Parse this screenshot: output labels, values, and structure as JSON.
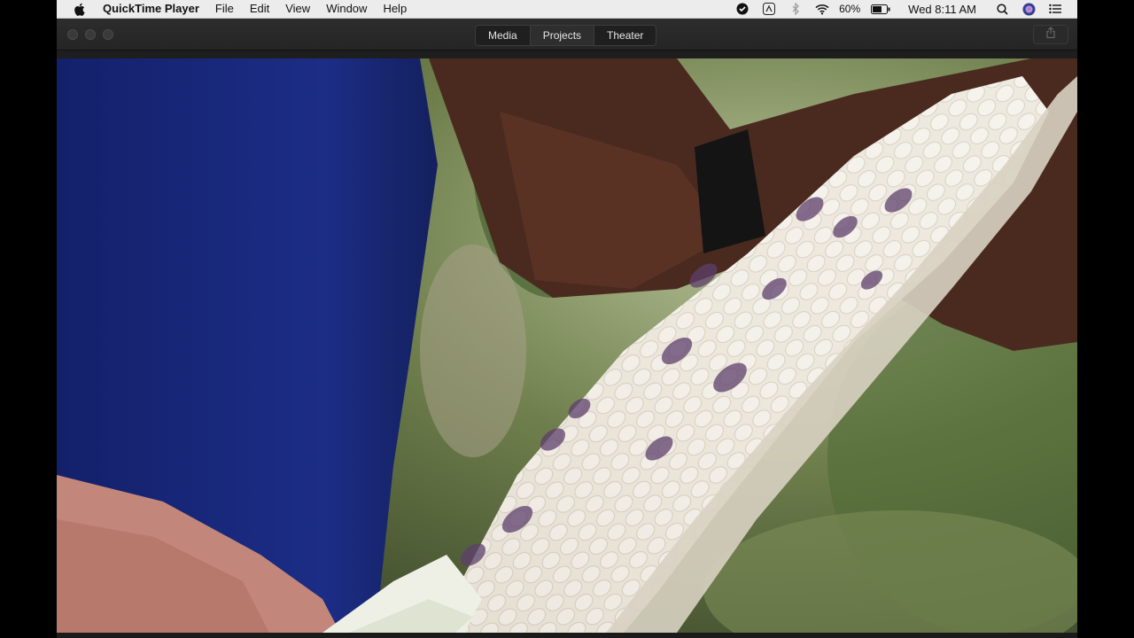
{
  "menubar": {
    "apple_icon": "apple-logo-icon",
    "app_name": "QuickTime Player",
    "items": [
      "File",
      "Edit",
      "View",
      "Window",
      "Help"
    ],
    "battery_percent": "60%",
    "clock": "Wed 8:11 AM",
    "status_icons": [
      "dark-circle-check-icon",
      "adobe-icon",
      "bluetooth-icon",
      "wifi-icon",
      "battery-icon",
      "search-icon",
      "siri-icon",
      "notification-list-icon"
    ]
  },
  "window": {
    "tabs": [
      "Media",
      "Projects",
      "Theater"
    ],
    "share_icon": "share-icon"
  },
  "video": {
    "description_colors": {
      "shirt": "#1b2a7a",
      "corn_kernel": "#ece7dc",
      "purple_kernel": "#6a4a76",
      "foliage": "#6d7b4c",
      "skin": "#5a3526"
    }
  }
}
